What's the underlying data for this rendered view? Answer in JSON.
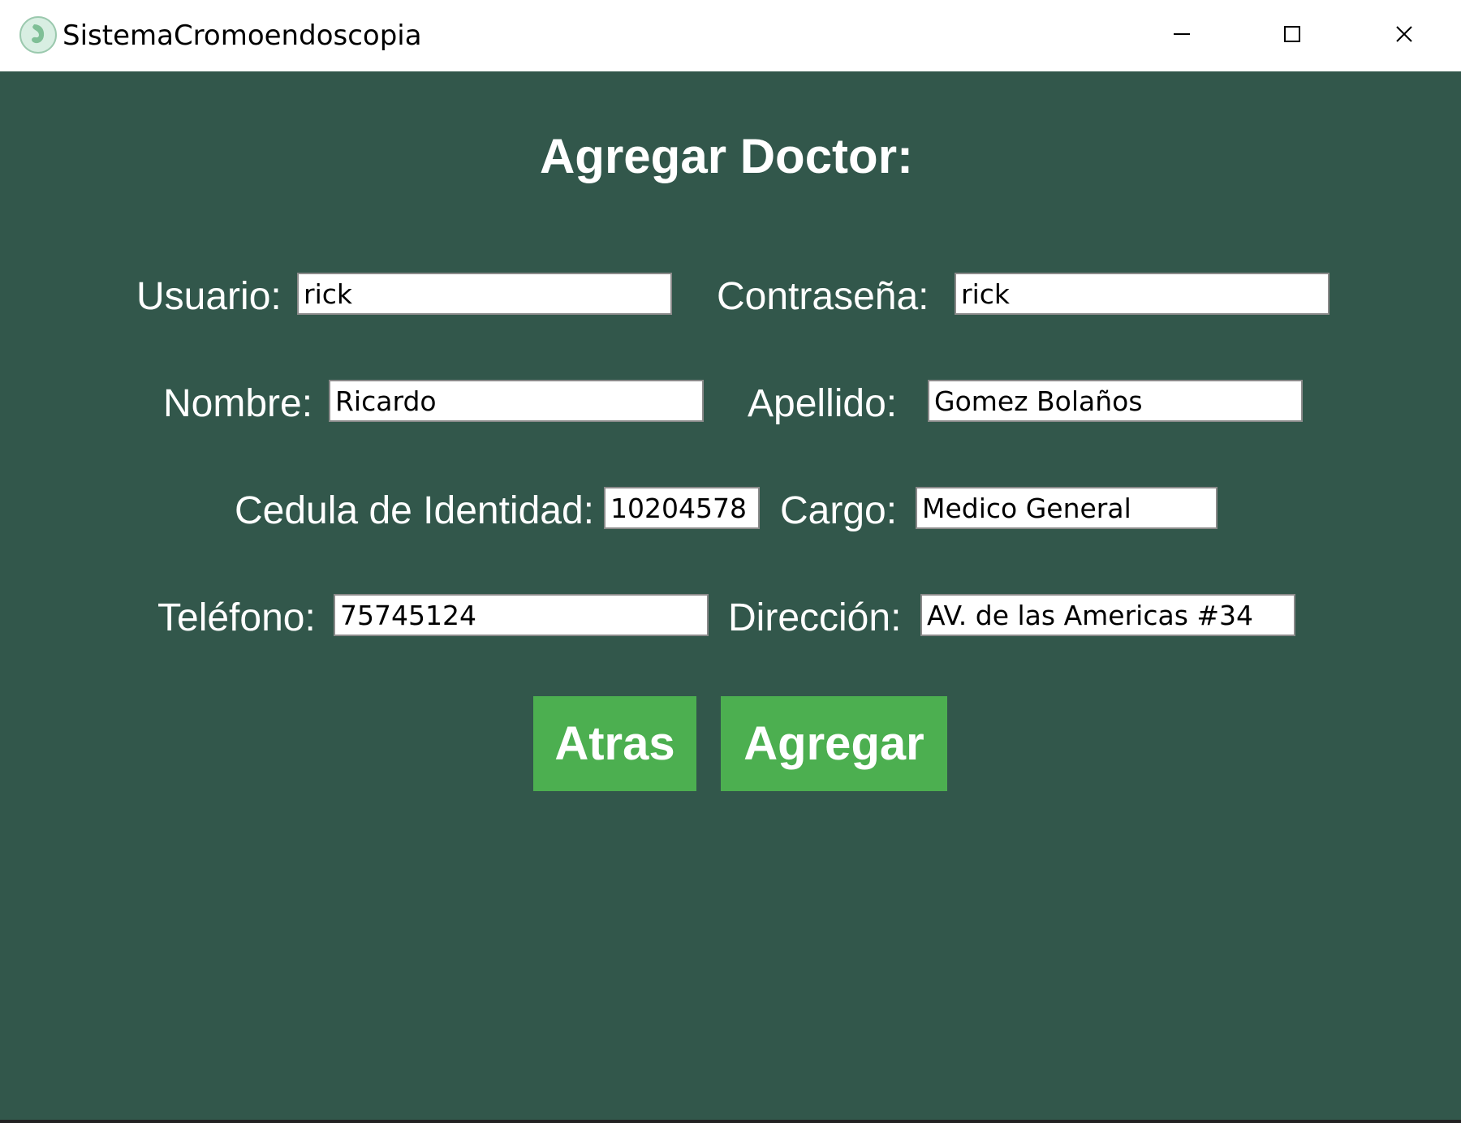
{
  "window": {
    "title": "SistemaCromoendoscopia",
    "icon": "stomach-app-icon",
    "controls": [
      "minimize-icon",
      "maximize-icon",
      "close-icon"
    ]
  },
  "form": {
    "title": "Agregar Doctor:",
    "fields": {
      "usuario": {
        "label": "Usuario:",
        "value": "rick"
      },
      "contrasena": {
        "label": "Contraseña:",
        "value": "rick"
      },
      "nombre": {
        "label": "Nombre:",
        "value": "Ricardo"
      },
      "apellido": {
        "label": "Apellido:",
        "value": "Gomez Bolaños"
      },
      "cedula": {
        "label": "Cedula de Identidad:",
        "value": "10204578"
      },
      "cargo": {
        "label": "Cargo:",
        "value": "Medico General"
      },
      "telefono": {
        "label": "Teléfono:",
        "value": "75745124"
      },
      "direccion": {
        "label": "Dirección:",
        "value": "AV. de las Americas #34"
      }
    },
    "buttons": {
      "back": "Atras",
      "add": "Agregar"
    }
  },
  "colors": {
    "background": "#32574b",
    "button": "#4caf50",
    "text": "#ffffff"
  }
}
